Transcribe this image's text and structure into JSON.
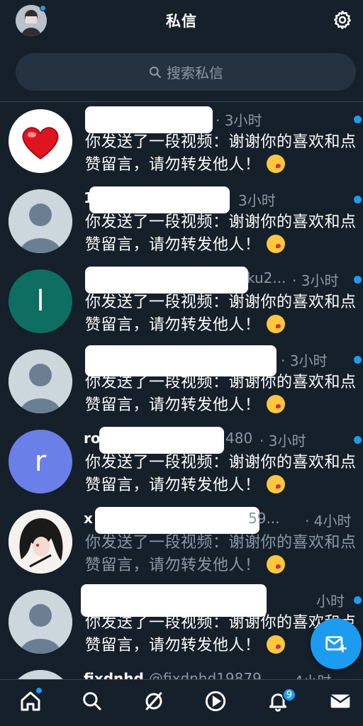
{
  "header": {
    "title": "私信",
    "avatar_icon": "user-avatar-icon",
    "settings_icon": "gear-icon"
  },
  "search": {
    "placeholder": "搜索私信"
  },
  "messages": [
    {
      "name_fragment": "",
      "time_label": "· 3小时",
      "preview": "你发送了一段视频：谢谢你的喜欢和点赞留言，请勿转发他人！",
      "emoji": "kissing-face-icon",
      "unread": true,
      "avatar_type": "heart"
    },
    {
      "name_fragment": "1",
      "time_label": "3小时",
      "preview": "你发送了一段视频：谢谢你的喜欢和点赞留言，请勿转发他人！",
      "emoji": "kissing-face-icon",
      "unread": true,
      "avatar_type": "default"
    },
    {
      "name_fragment": "ku2...",
      "time_label": "· 3小时",
      "preview": "你发送了一段视频：谢谢你的喜欢和点赞留言，请勿转发他人！",
      "emoji": "kissing-face-icon",
      "unread": true,
      "avatar_type": "letter",
      "avatar_letter": "l",
      "avatar_color": "#0f6e62"
    },
    {
      "name_fragment": "",
      "time_label": "· 3小时",
      "preview": "你发送了一段视频：谢谢你的喜欢和点赞留言，请勿转发他人！",
      "emoji": "kissing-face-icon",
      "unread": true,
      "avatar_type": "default"
    },
    {
      "name_fragment": "ro",
      "name_fragment_end": "480",
      "time_label": "· 3小时",
      "preview": "你发送了一段视频：谢谢你的喜欢和点赞留言，请勿转发他人！",
      "emoji": "kissing-face-icon",
      "unread": true,
      "avatar_type": "letter",
      "avatar_letter": "r",
      "avatar_color": "#6b7fe8"
    },
    {
      "name_fragment": "x",
      "name_fragment_end": "59...",
      "time_label": "· 4小时",
      "preview": "你发送了一段视频：谢谢你的喜欢和点赞留言，请勿转发他人！",
      "emoji": "kissing-face-icon",
      "unread": false,
      "avatar_type": "anime"
    },
    {
      "name_fragment": "",
      "time_label": "小时",
      "preview": "你发送了一段视频：谢谢你的喜欢和点赞留言，请勿转发他人！",
      "emoji": "kissing-face-icon",
      "unread": true,
      "avatar_type": "default"
    },
    {
      "name_fragment": "fixdnhd",
      "name_fragment_end": "@fixdnhd19879",
      "time_label": "· 4小时",
      "preview": "",
      "unread": false,
      "avatar_type": "default"
    }
  ],
  "fab": {
    "icon": "new-message-icon"
  },
  "bottom_nav": {
    "items": [
      "home-icon",
      "search-icon",
      "spaces-icon",
      "video-icon",
      "notifications-icon",
      "messages-icon"
    ],
    "notification_count": "9"
  },
  "colors": {
    "background": "#15202b",
    "accent": "#1d9bf0",
    "muted_text": "#8b98a5"
  }
}
